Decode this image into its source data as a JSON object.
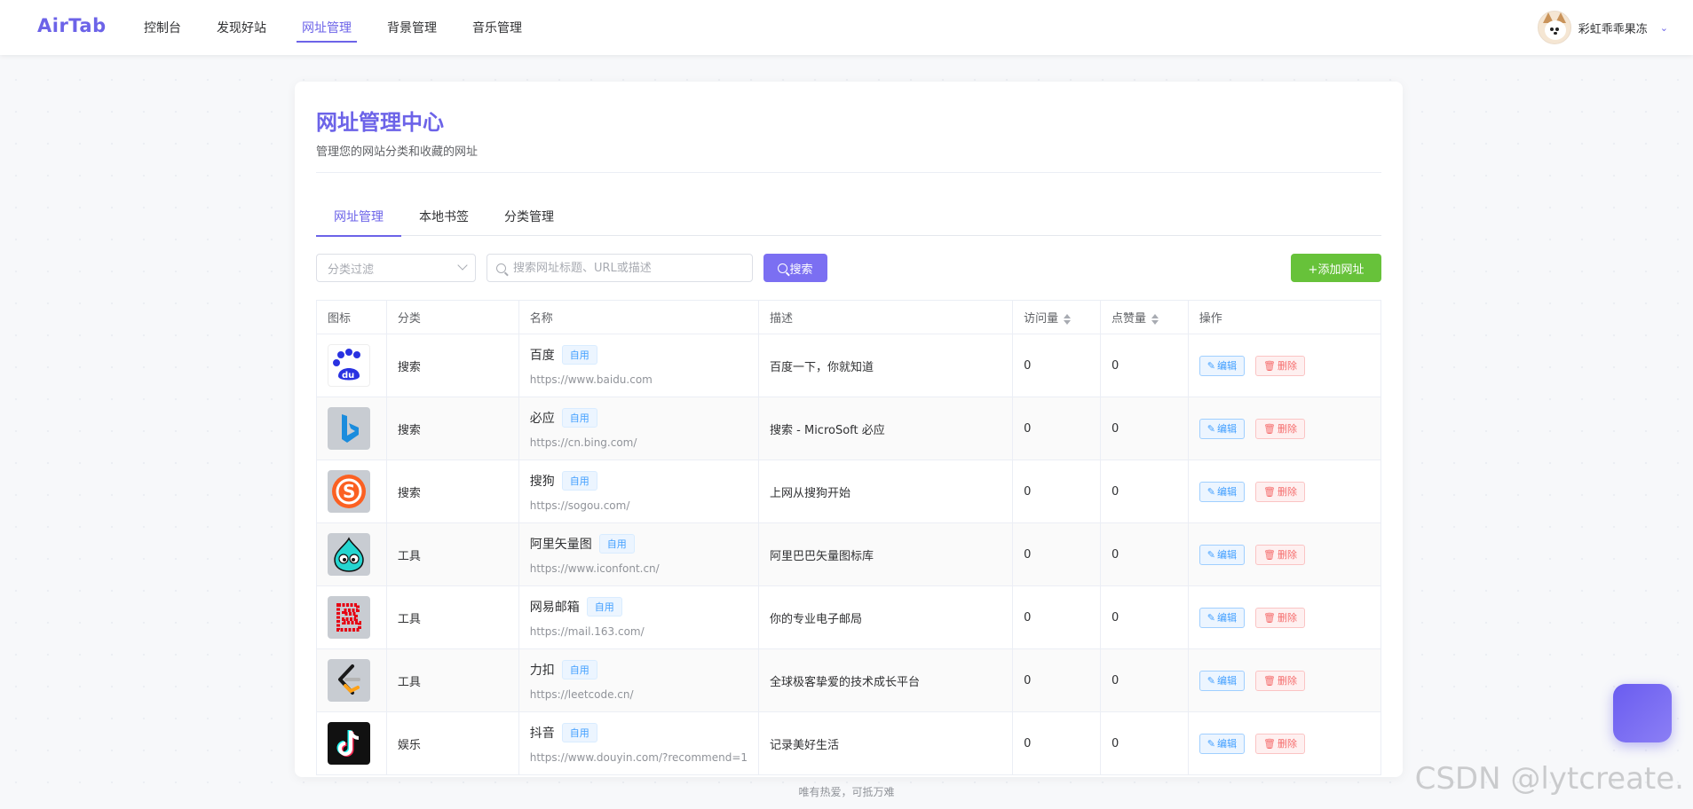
{
  "app": {
    "logo": "AirTab"
  },
  "nav": [
    {
      "label": "控制台",
      "active": false
    },
    {
      "label": "发现好站",
      "active": false
    },
    {
      "label": "网址管理",
      "active": true
    },
    {
      "label": "背景管理",
      "active": false
    },
    {
      "label": "音乐管理",
      "active": false
    }
  ],
  "user": {
    "name": "彩虹乖乖果冻",
    "caret": "⌄"
  },
  "page": {
    "title": "网址管理中心",
    "subtitle": "管理您的网站分类和收藏的网址"
  },
  "tabs": [
    {
      "label": "网址管理",
      "active": true
    },
    {
      "label": "本地书签",
      "active": false
    },
    {
      "label": "分类管理",
      "active": false
    }
  ],
  "toolbar": {
    "filter_placeholder": "分类过滤",
    "search_placeholder": "搜索网址标题、URL或描述",
    "search_label": "搜索",
    "add_label": "+添加网址"
  },
  "table": {
    "headers": [
      "图标",
      "分类",
      "名称",
      "描述",
      "访问量",
      "点赞量",
      "操作"
    ],
    "edit_label": "编辑",
    "delete_label": "删除",
    "rows": [
      {
        "icon": "baidu-icon",
        "category": "搜索",
        "name": "百度",
        "tag": "自用",
        "url": "https://www.baidu.com",
        "desc": "百度一下，你就知道",
        "visits": "0",
        "likes": "0"
      },
      {
        "icon": "bing-icon",
        "category": "搜索",
        "name": "必应",
        "tag": "自用",
        "url": "https://cn.bing.com/",
        "desc": "搜索 - MicroSoft 必应",
        "visits": "0",
        "likes": "0"
      },
      {
        "icon": "sogou-icon",
        "category": "搜索",
        "name": "搜狗",
        "tag": "自用",
        "url": "https://sogou.com/",
        "desc": "上网从搜狗开始",
        "visits": "0",
        "likes": "0"
      },
      {
        "icon": "iconfont-icon",
        "category": "工具",
        "name": "阿里矢量图",
        "tag": "自用",
        "url": "https://www.iconfont.cn/",
        "desc": "阿里巴巴矢量图标库",
        "visits": "0",
        "likes": "0"
      },
      {
        "icon": "mail163-icon",
        "category": "工具",
        "name": "网易邮箱",
        "tag": "自用",
        "url": "https://mail.163.com/",
        "desc": "你的专业电子邮局",
        "visits": "0",
        "likes": "0"
      },
      {
        "icon": "leetcode-icon",
        "category": "工具",
        "name": "力扣",
        "tag": "自用",
        "url": "https://leetcode.cn/",
        "desc": "全球极客挚爱的技术成长平台",
        "visits": "0",
        "likes": "0"
      },
      {
        "icon": "douyin-icon",
        "category": "娱乐",
        "name": "抖音",
        "tag": "自用",
        "url": "https://www.douyin.com/?recommend=1",
        "desc": "记录美好生活",
        "visits": "0",
        "likes": "0"
      }
    ]
  },
  "footer": "唯有热爱，可抵万难",
  "watermark": "CSDN @lytcreate.",
  "colors": {
    "accent": "#6c63e8",
    "success": "#67c23a",
    "edit": "#409eff",
    "danger": "#f56c6c"
  }
}
